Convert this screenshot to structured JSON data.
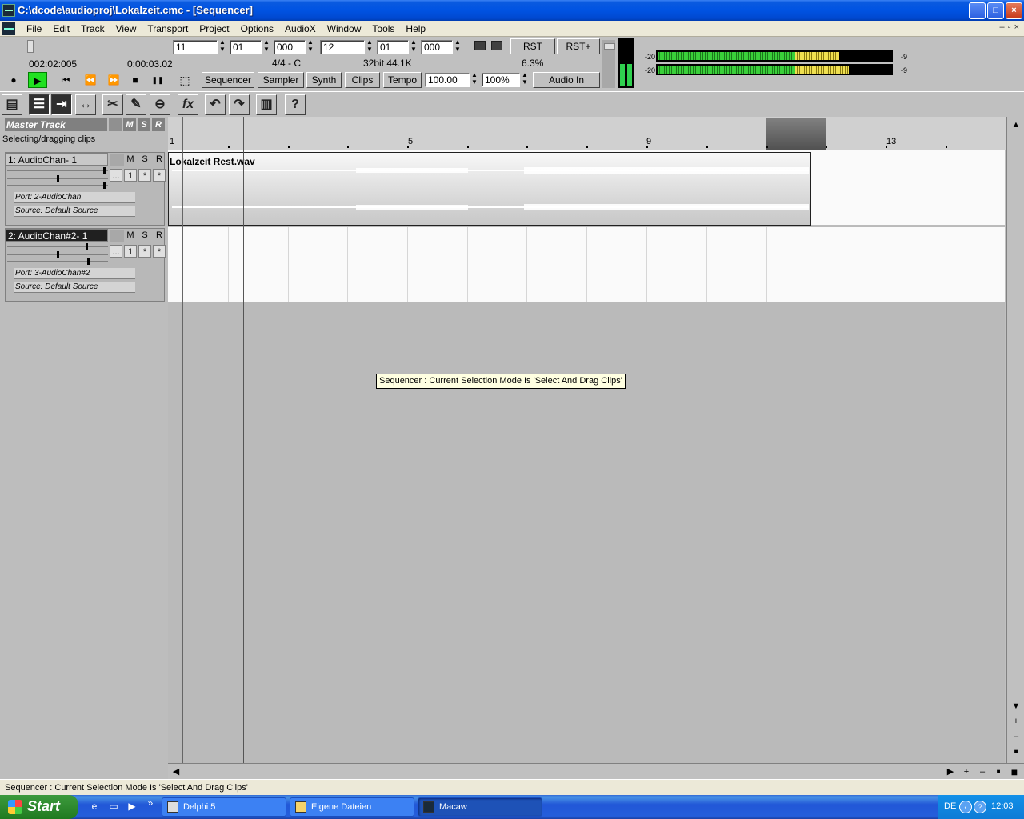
{
  "window": {
    "title": "C:\\dcode\\audioproj\\Lokalzeit.cmc - [Sequencer]",
    "controls": [
      "_",
      "□",
      "×"
    ]
  },
  "menu": {
    "items": [
      "File",
      "Edit",
      "Track",
      "View",
      "Transport",
      "Project",
      "Options",
      "AudioX",
      "Window",
      "Tools",
      "Help"
    ],
    "mdi_controls": [
      "–",
      "▫",
      "×"
    ]
  },
  "transport": {
    "from_bar": "11",
    "from_beat": "01",
    "from_tick": "000",
    "to_bar": "12",
    "to_beat": "01",
    "to_tick": "000",
    "rst": "RST",
    "rst_plus": "RST+",
    "position_bbt": "002:02:005",
    "position_time": "0:00:03.02",
    "signature": "4/4 - C",
    "format": "32bit 44.1K",
    "cpu": "6.3%",
    "tabs": [
      "Sequencer",
      "Sampler",
      "Synth",
      "Clips",
      "Tempo"
    ],
    "tempo": "100.00",
    "zoom": "100%",
    "audio_in": "Audio In",
    "buttons": {
      "record": "●",
      "play": "▶",
      "to_start": "⏮",
      "rewind": "⏪",
      "forward": "⏩",
      "stop": "■",
      "pause": "❚❚",
      "loop": "⬚"
    }
  },
  "meters": {
    "left_label": "-20",
    "right_label": "-9",
    "rows": [
      {
        "label_left": "-20",
        "label_right": "-9",
        "green": 0.59,
        "yellow": 0.19
      },
      {
        "label_left": "-20",
        "label_right": "-9",
        "green": 0.59,
        "yellow": 0.23
      }
    ]
  },
  "tools": [
    "▤",
    "☰",
    "⇥",
    "↔",
    "✂",
    "✎",
    "⊖",
    "fx",
    "↶",
    "↷",
    "▥",
    "?"
  ],
  "master": {
    "name": "Master Track",
    "m": "M",
    "s": "S",
    "r": "R",
    "status": "Selecting/dragging clips"
  },
  "tracks": [
    {
      "name": "1: AudioChan- 1",
      "m": "M",
      "s": "S",
      "r": "R",
      "dots": "...",
      "ch": "1",
      "star1": "*",
      "star2": "*",
      "port": "Port: 2-AudioChan",
      "source": "Source: Default Source"
    },
    {
      "name": "2: AudioChan#2- 1",
      "m": "M",
      "s": "S",
      "r": "R",
      "dots": "...",
      "ch": "1",
      "star1": "*",
      "star2": "*",
      "port": "Port: 3-AudioChan#2",
      "source": "Source: Default Source"
    }
  ],
  "ruler": {
    "numbers": [
      "1",
      "5",
      "9",
      "13"
    ]
  },
  "clip": {
    "name": "Lokalzeit Rest.wav"
  },
  "tooltip": "Sequencer : Current Selection Mode Is 'Select And Drag Clips'",
  "statusbar": "Sequencer : Current Selection Mode Is 'Select And Drag Clips'",
  "taskbar": {
    "start": "Start",
    "tasks": [
      "Delphi 5",
      "Eigene Dateien",
      "Macaw"
    ],
    "lang": "DE",
    "clock": "12:03"
  }
}
